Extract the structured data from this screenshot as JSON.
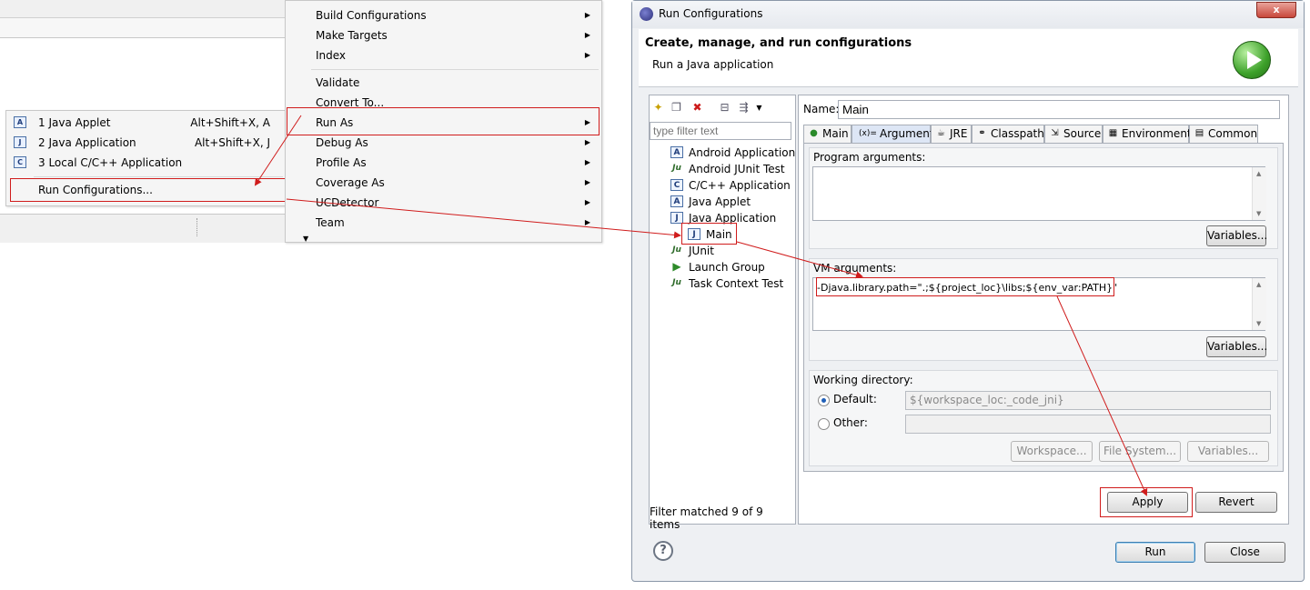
{
  "context_menu": {
    "items": [
      {
        "label": "Build Configurations",
        "arrow": true
      },
      {
        "label": "Make Targets",
        "arrow": true
      },
      {
        "label": "Index",
        "arrow": true
      },
      {
        "label": "Validate",
        "arrow": false
      },
      {
        "label": "Convert To...",
        "arrow": false
      },
      {
        "label": "Run As",
        "arrow": true
      },
      {
        "label": "Debug As",
        "arrow": true
      },
      {
        "label": "Profile As",
        "arrow": true
      },
      {
        "label": "Coverage As",
        "arrow": true
      },
      {
        "label": "UCDetector",
        "arrow": true
      },
      {
        "label": "Team",
        "arrow": true
      }
    ],
    "arrow_glyph": "▶",
    "more_glyph": "▼"
  },
  "run_as_submenu": {
    "items": [
      {
        "label": "1 Java Applet",
        "shortcut": "Alt+Shift+X, A",
        "icon": "java-applet-icon",
        "icon_text": "A"
      },
      {
        "label": "2 Java Application",
        "shortcut": "Alt+Shift+X, J",
        "icon": "java-application-icon",
        "icon_text": "J"
      },
      {
        "label": "3 Local C/C++ Application",
        "shortcut": "",
        "icon": "c-application-icon",
        "icon_text": "C"
      }
    ],
    "run_configurations": "Run Configurations..."
  },
  "dialog": {
    "title": "Run Configurations",
    "close_glyph": "x",
    "header_title": "Create, manage, and run configurations",
    "header_subtitle": "Run a Java application",
    "filter_placeholder": "type filter text",
    "tree": [
      {
        "label": "Android Application",
        "icon": "android-application-icon",
        "icon_text": "A",
        "indent": 0
      },
      {
        "label": "Android JUnit Test",
        "icon": "android-junit-icon",
        "icon_text": "Ju",
        "indent": 0
      },
      {
        "label": "C/C++ Application",
        "icon": "c-application-icon",
        "icon_text": "C",
        "indent": 0
      },
      {
        "label": "Java Applet",
        "icon": "java-applet-icon",
        "icon_text": "A",
        "indent": 0
      },
      {
        "label": "Java Application",
        "icon": "java-application-icon",
        "icon_text": "J",
        "indent": 0
      },
      {
        "label": "Main",
        "icon": "java-application-icon",
        "icon_text": "J",
        "indent": 1
      },
      {
        "label": "JUnit",
        "icon": "junit-icon",
        "icon_text": "Ju",
        "indent": 0
      },
      {
        "label": "Launch Group",
        "icon": "launch-group-icon",
        "icon_text": "▶",
        "indent": 0
      },
      {
        "label": "Task Context Test",
        "icon": "task-context-icon",
        "icon_text": "Ju",
        "indent": 0
      }
    ],
    "filter_status": "Filter matched 9 of 9 items",
    "name_label": "Name:",
    "name_value": "Main",
    "tabs": [
      {
        "label": "Main",
        "icon": "main-tab-icon",
        "glyph": "●",
        "selected": false
      },
      {
        "label": "Arguments",
        "icon": "arguments-tab-icon",
        "glyph": "(x)=",
        "selected": true
      },
      {
        "label": "JRE",
        "icon": "jre-tab-icon",
        "glyph": "☕",
        "selected": false
      },
      {
        "label": "Classpath",
        "icon": "classpath-tab-icon",
        "glyph": "⚭",
        "selected": false
      },
      {
        "label": "Source",
        "icon": "source-tab-icon",
        "glyph": "⇲",
        "selected": false
      },
      {
        "label": "Environment",
        "icon": "environment-tab-icon",
        "glyph": "▦",
        "selected": false
      },
      {
        "label": "Common",
        "icon": "common-tab-icon",
        "glyph": "▤",
        "selected": false
      }
    ],
    "program_arguments_label": "Program arguments:",
    "program_arguments_value": "",
    "vm_arguments_label": "VM arguments:",
    "vm_arguments_value": "-Djava.library.path=\".;${project_loc}\\libs;${env_var:PATH}\"",
    "variables_label": "Variables...",
    "working_directory_label": "Working directory:",
    "default_label": "Default:",
    "default_value": "${workspace_loc:_code_jni}",
    "other_label": "Other:",
    "other_value": "",
    "workspace_button": "Workspace...",
    "file_system_button": "File System...",
    "apply_button": "Apply",
    "revert_button": "Revert",
    "run_button": "Run",
    "close_button": "Close",
    "help_glyph": "?"
  },
  "colors": {
    "annotation": "#d01c1c"
  }
}
